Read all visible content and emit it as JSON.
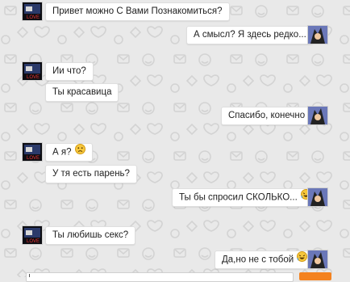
{
  "colors": {
    "background": "#e9e9e9",
    "bubble": "#ffffff",
    "accent": "#f4821f"
  },
  "messages": [
    {
      "side": "left",
      "avatar": "tv-avatar",
      "text": "Привет можно С Вами Познакомиться?"
    },
    {
      "side": "right",
      "avatar": "anime-avatar",
      "text": "А смысл? Я здесь редко..."
    },
    {
      "side": "left",
      "avatar": "tv-avatar",
      "text": "Ии что?"
    },
    {
      "side": "left",
      "avatar": "",
      "text": "Ты красавица"
    },
    {
      "side": "right",
      "avatar": "anime-avatar",
      "text": "Спасибо, конечно"
    },
    {
      "side": "left",
      "avatar": "tv-avatar",
      "text": "А я?",
      "emoji": "sad-face-emoji"
    },
    {
      "side": "left",
      "avatar": "",
      "text": "У тя есть парень?"
    },
    {
      "side": "right",
      "avatar": "anime-avatar",
      "text": "Ты бы спросил СКОЛЬКО...",
      "emoji": "laughing-face-emoji"
    },
    {
      "side": "left",
      "avatar": "tv-avatar",
      "text": "Ты любишь секс?"
    },
    {
      "side": "right",
      "avatar": "anime-avatar",
      "text": "Да,но не с тобой",
      "emoji": "laughing-face-emoji"
    }
  ]
}
